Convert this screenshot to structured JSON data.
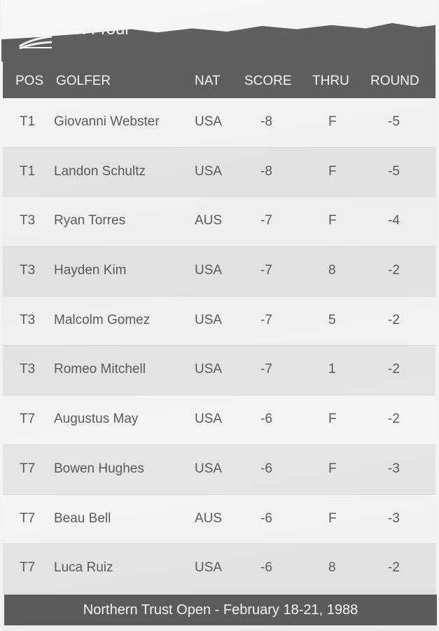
{
  "tour": {
    "name": "PGA Tour"
  },
  "columns": [
    "POS",
    "GOLFER",
    "NAT",
    "SCORE",
    "THRU",
    "ROUND"
  ],
  "rows": [
    {
      "pos": "T1",
      "golfer": "Giovanni Webster",
      "nat": "USA",
      "score": "-8",
      "thru": "F",
      "round": "-5"
    },
    {
      "pos": "T1",
      "golfer": "Landon Schultz",
      "nat": "USA",
      "score": "-8",
      "thru": "F",
      "round": "-5"
    },
    {
      "pos": "T3",
      "golfer": "Ryan Torres",
      "nat": "AUS",
      "score": "-7",
      "thru": "F",
      "round": "-4"
    },
    {
      "pos": "T3",
      "golfer": "Hayden Kim",
      "nat": "USA",
      "score": "-7",
      "thru": "8",
      "round": "-2"
    },
    {
      "pos": "T3",
      "golfer": "Malcolm Gomez",
      "nat": "USA",
      "score": "-7",
      "thru": "5",
      "round": "-2"
    },
    {
      "pos": "T3",
      "golfer": "Romeo Mitchell",
      "nat": "USA",
      "score": "-7",
      "thru": "1",
      "round": "-2"
    },
    {
      "pos": "T7",
      "golfer": "Augustus May",
      "nat": "USA",
      "score": "-6",
      "thru": "F",
      "round": "-2"
    },
    {
      "pos": "T7",
      "golfer": "Bowen Hughes",
      "nat": "USA",
      "score": "-6",
      "thru": "F",
      "round": "-3"
    },
    {
      "pos": "T7",
      "golfer": "Beau Bell",
      "nat": "AUS",
      "score": "-6",
      "thru": "F",
      "round": "-3"
    },
    {
      "pos": "T7",
      "golfer": "Luca Ruiz",
      "nat": "USA",
      "score": "-6",
      "thru": "8",
      "round": "-2"
    }
  ],
  "footer": {
    "event": "Northern Trust Open - February 18-21, 1988"
  }
}
